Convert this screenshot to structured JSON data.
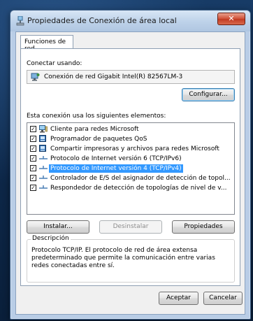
{
  "window": {
    "title": "Propiedades de Conexión de área local",
    "close_glyph": "✕"
  },
  "tabs": [
    {
      "label": "Funciones de red"
    }
  ],
  "connect_using": {
    "label": "Conectar usando:",
    "adapter": "Conexión de red Gigabit Intel(R) 82567LM-3",
    "adapter_icon": "network-adapter-icon"
  },
  "configure_button": "Configurar...",
  "items_label": "Esta conexión usa los siguientes elementos:",
  "items": [
    {
      "label": "Cliente para redes Microsoft",
      "checked": true,
      "icon": "network-client-icon"
    },
    {
      "label": "Programador de paquetes QoS",
      "checked": true,
      "icon": "network-service-icon"
    },
    {
      "label": "Compartir impresoras y archivos para redes Microsoft",
      "checked": true,
      "icon": "network-service-icon"
    },
    {
      "label": "Protocolo de Internet versión 6 (TCP/IPv6)",
      "checked": true,
      "icon": "protocol-icon"
    },
    {
      "label": "Protocolo de Internet versión 4 (TCP/IPv4)",
      "checked": true,
      "icon": "protocol-icon",
      "selected": true
    },
    {
      "label": "Controlador de E/S del asignador de detección de topol...",
      "checked": true,
      "icon": "protocol-icon"
    },
    {
      "label": "Respondedor de detección de topologías de nivel de v...",
      "checked": true,
      "icon": "protocol-icon"
    }
  ],
  "buttons": {
    "install": "Instalar...",
    "uninstall": "Desinstalar",
    "properties": "Propiedades"
  },
  "description": {
    "legend": "Descripción",
    "text": "Protocolo TCP/IP. El protocolo de red de área extensa predeterminado que permite la comunicación entre varias redes conectadas entre sí."
  },
  "footer": {
    "ok": "Aceptar",
    "cancel": "Cancelar"
  },
  "colors": {
    "selection": "#3399ff",
    "close_button": "#c23a22",
    "titlebar": "#bfd3ea"
  }
}
